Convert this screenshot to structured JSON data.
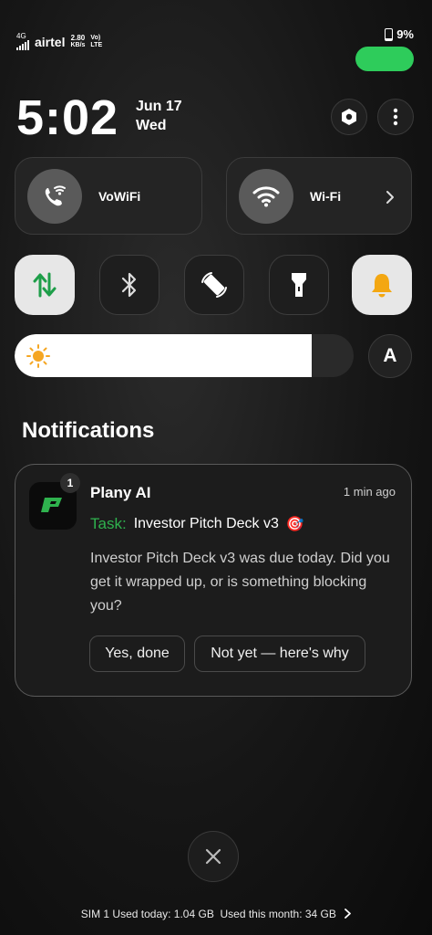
{
  "status_bar": {
    "network_type": "4G",
    "carrier": "airtel",
    "speed_value": "2.80",
    "speed_unit": "KB/s",
    "volte_1": "Vo)",
    "volte_2": "LTE",
    "battery_percent": "9%",
    "pill_color": "#2ecc5b"
  },
  "header": {
    "time": "5:02",
    "date": "Jun 17",
    "day": "Wed"
  },
  "tiles": {
    "vowifi_label": "VoWiFi",
    "wifi_label": "Wi-Fi"
  },
  "quick_toggles": [
    {
      "name": "mobile-data",
      "active": true
    },
    {
      "name": "bluetooth",
      "active": false
    },
    {
      "name": "auto-rotate",
      "active": false
    },
    {
      "name": "flashlight",
      "active": false
    },
    {
      "name": "sound",
      "active": true
    }
  ],
  "brightness": {
    "level": 0.875,
    "auto_label": "A"
  },
  "notifications": {
    "heading": "Notifications",
    "items": [
      {
        "app": "Plany AI",
        "badge_count": "1",
        "time": "1 min ago",
        "task_label": "Task:",
        "task_title": "Investor Pitch Deck v3",
        "task_emoji": "🎯",
        "body": "Investor Pitch Deck v3 was due today. Did you get it wrapped up, or is something blocking you?",
        "actions": [
          "Yes, done",
          "Not yet — here's why"
        ],
        "accent": "#2fb24e"
      }
    ]
  },
  "footer": {
    "text": "SIM 1 Used today: 1.04 GB  Used this month: 34 GB"
  }
}
